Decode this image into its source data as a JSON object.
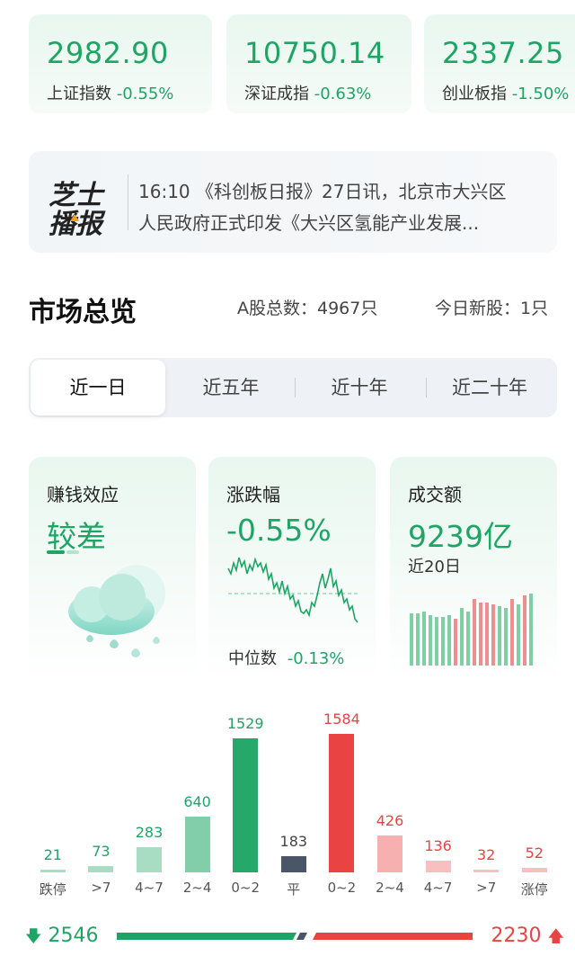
{
  "indices": [
    {
      "value": "2982.90",
      "name": "上证指数",
      "change": "-0.55%"
    },
    {
      "value": "10750.14",
      "name": "深证成指",
      "change": "-0.63%"
    },
    {
      "value": "2337.25",
      "name": "创业板指",
      "change": "-1.50%"
    }
  ],
  "news": {
    "logo_line1": "芝士",
    "logo_line2": "播报",
    "line1": "16:10 《科创板日报》27日讯，北京市大兴区",
    "line2": "人民政府正式印发《大兴区氢能产业发展..."
  },
  "overview": {
    "title": "市场总览",
    "a_shares": "A股总数：4967只",
    "new_shares": "今日新股：1只"
  },
  "tabs": [
    "近一日",
    "近五年",
    "近十年",
    "近二十年"
  ],
  "cards": {
    "sentiment": {
      "title": "赚钱效应",
      "value": "较差",
      "icon": "rain-cloud-icon"
    },
    "change": {
      "title": "涨跌幅",
      "value": "-0.55%",
      "median_label": "中位数",
      "median_value": "-0.13%"
    },
    "turnover": {
      "title": "成交额",
      "value": "9239亿",
      "period": "近20日"
    }
  },
  "colors": {
    "green": "#1ea565",
    "red": "#e94343",
    "gray_bar": "#4a5568"
  },
  "chart_data": {
    "type": "bar",
    "categories": [
      "跌停",
      ">7",
      "4~7",
      "2~4",
      "0~2",
      "平",
      "0~2",
      "2~4",
      "4~7",
      ">7",
      "涨停"
    ],
    "values": [
      21,
      73,
      283,
      640,
      1529,
      183,
      1584,
      426,
      136,
      32,
      52
    ],
    "labels": [
      "21",
      "73",
      "283",
      "640",
      "1529",
      "183",
      "1584",
      "426",
      "136",
      "32",
      "52"
    ],
    "directions": [
      "down",
      "down",
      "down",
      "down",
      "down",
      "flat",
      "up",
      "up",
      "up",
      "up",
      "up"
    ]
  },
  "balance": {
    "down_count": "2546",
    "up_count": "2230",
    "down_ratio": 0.533
  }
}
